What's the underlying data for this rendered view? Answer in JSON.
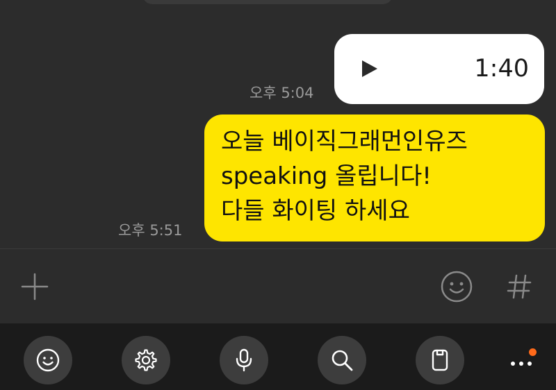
{
  "messages": [
    {
      "type": "voice",
      "duration": "1:40",
      "time": "오후 5:04"
    },
    {
      "type": "text",
      "lines": [
        "오늘 베이직그래먼인유즈",
        "speaking 올립니다!",
        "다들 화이팅 하세요"
      ],
      "time": "오후 5:51"
    }
  ],
  "input_bar": {
    "left_icon": "plus-icon",
    "right_icons": [
      "emoji-icon",
      "hash-icon"
    ]
  },
  "toolbar": {
    "icons": [
      "emoji-icon",
      "gear-icon",
      "microphone-icon",
      "search-icon",
      "clipboard-icon",
      "more-icon"
    ],
    "notification_dot_color": "#ff6a1a"
  },
  "colors": {
    "background": "#2c2c2c",
    "toolbar_background": "#1b1b1b",
    "bubble_yellow": "#fee500",
    "bubble_white": "#ffffff",
    "timestamp": "#9a9a9a"
  }
}
